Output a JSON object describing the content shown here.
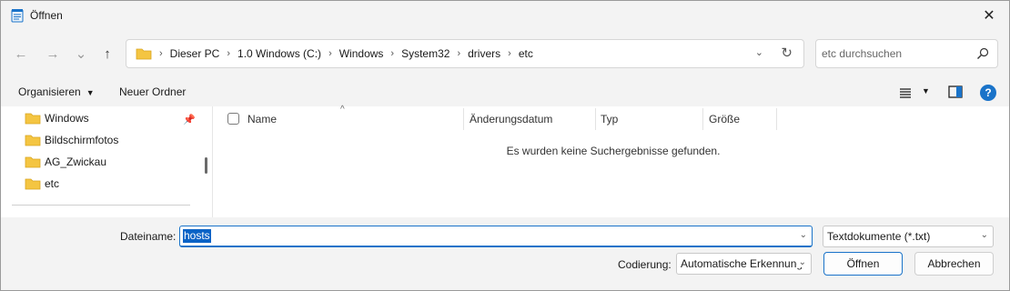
{
  "window": {
    "title": "Öffnen",
    "close_glyph": "✕"
  },
  "nav": {
    "back_glyph": "←",
    "forward_glyph": "→",
    "recent_glyph": "⌄",
    "up_glyph": "↑",
    "breadcrumbs": [
      {
        "label": "Dieser PC"
      },
      {
        "label": "1.0 Windows (C:)"
      },
      {
        "label": "Windows"
      },
      {
        "label": "System32"
      },
      {
        "label": "drivers"
      },
      {
        "label": "etc"
      }
    ],
    "crumb_separator": "›",
    "dropdown_glyph": "⌄",
    "refresh_glyph": "↻"
  },
  "search": {
    "placeholder": "etc durchsuchen"
  },
  "commands": {
    "organize_label": "Organisieren",
    "organize_caret": "▼",
    "new_folder_label": "Neuer Ordner",
    "view_caret": "▼",
    "help_glyph": "?"
  },
  "navpane": {
    "pin_glyph": "📌",
    "items": [
      {
        "label": "Windows"
      },
      {
        "label": "Bildschirmfotos"
      },
      {
        "label": "AG_Zwickau"
      },
      {
        "label": "etc"
      }
    ]
  },
  "list": {
    "sort_caret": "^",
    "columns": [
      {
        "label": "Name"
      },
      {
        "label": "Änderungsdatum"
      },
      {
        "label": "Typ"
      },
      {
        "label": "Größe"
      }
    ],
    "empty_message": "Es wurden keine Suchergebnisse gefunden."
  },
  "bottom": {
    "filename_label": "Dateiname:",
    "filename_value": "hosts",
    "filetype_value": "Textdokumente (*.txt)",
    "encoding_label": "Codierung:",
    "encoding_value": "Automatische Erkennung",
    "open_label": "Öffnen",
    "cancel_label": "Abbrechen",
    "dropdown_glyph": "⌄"
  },
  "colors": {
    "accent": "#1a73c9",
    "folder": "#f4c542",
    "selection": "#0b63c6"
  }
}
